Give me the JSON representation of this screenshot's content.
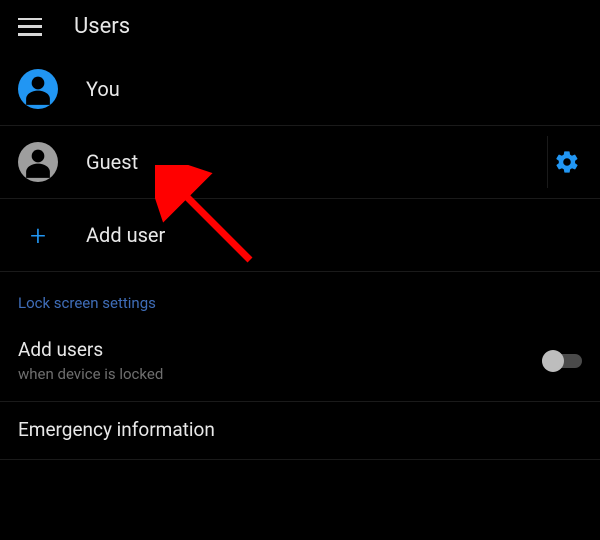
{
  "header": {
    "title": "Users"
  },
  "users": [
    {
      "label": "You",
      "avatar_color": "blue"
    },
    {
      "label": "Guest",
      "avatar_color": "gray",
      "has_settings": true
    }
  ],
  "add_user_label": "Add user",
  "lockscreen": {
    "section_header": "Lock screen settings",
    "add_users": {
      "title": "Add users",
      "subtitle": "when device is locked",
      "enabled": false
    },
    "emergency": {
      "title": "Emergency information"
    }
  },
  "colors": {
    "accent": "#2196f3"
  }
}
